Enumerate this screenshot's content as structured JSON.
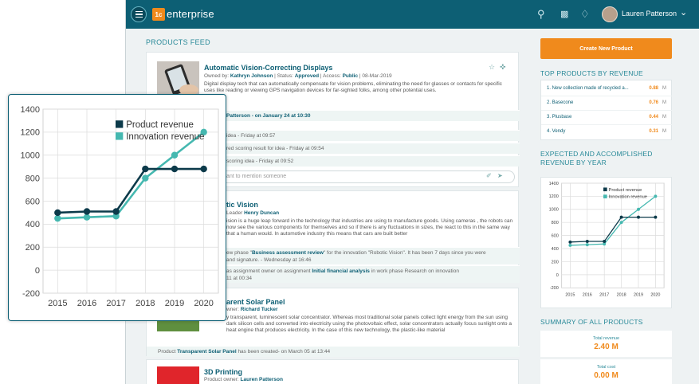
{
  "topbar": {
    "logo_badge": "1c",
    "logo_text": "enterprise",
    "user_name": "Lauren Patterson"
  },
  "feed": {
    "title": "PRODUCTS FEED",
    "card1": {
      "title": "Automatic Vision-Correcting Displays",
      "owned_by_label": "Owned by:",
      "owner": "Kathryn Johnson",
      "status_label": "| Status:",
      "status": "Approved",
      "access_label": "| Access:",
      "access": "Public",
      "date": "| 08-Mar-2019",
      "description": "Digital display tech that can automatically compensate for vision problems, eliminating the need for glasses or contacts for specific uses like reading or viewing GPS navigation devices for far-sighted folks, among other potential uses.",
      "activities": [
        "Patterson - on January 24 at 10:30",
        "idea - Friday at 09:57",
        "red scoring result for idea - Friday at 09:54",
        "scoring idea - Friday at 09:52"
      ],
      "comment_placeholder": "want to mention someone"
    },
    "card2": {
      "title": "tic Vision",
      "leader_label": "Leader",
      "leader": "Henry Duncan",
      "description": "ision is a huge leap forward in the technology that industries are using to manufacture goods. Using cameras , the robots can now see the various components for themselves and so if there is any fluctuations in sizes, the react to this in the same way that a human would. In automotive industry this means that cars are built better",
      "activity1_a": "ew phase \"",
      "activity1_link": "Business assessment review",
      "activity1_b": "\" for the innovation \"Robotic Vision\". It has been 7 days since you were",
      "activity1_c": "and signature. - Wednesday at 16:46",
      "activity2_a": "as assignment owner on assignment ",
      "activity2_link": "Initial financial analysis",
      "activity2_b": " in work phase Research on innovation",
      "activity2_c": "11 at 00:34"
    },
    "card3": {
      "title": "arent Solar Panel",
      "owner_label": "wner:",
      "owner": "Richard Tucker",
      "description": "y transparent, luminescent solar concentrator. Whereas most traditional solar panels collect light energy from the sun using dark silicon cells and converted into electricity using the photovoltaic effect, solar concentrators actually focus sunlight onto a heat engine that produces electricity. In the case of this new technology, the plastic-like material",
      "activity_a": "Product ",
      "activity_link": "Transparent Solar Panel",
      "activity_b": " has been created- on March 05 at 13:44"
    },
    "card4": {
      "title": "3D Printing",
      "owner_label": "Product owner:",
      "owner": "Lauren Patterson"
    }
  },
  "sidebar": {
    "create_button": "Create New Product",
    "top_title": "TOP PRODUCTS BY REVENUE",
    "top_products": [
      {
        "name": "1. New collection made of recycled a...",
        "value": "0.88",
        "unit": "M"
      },
      {
        "name": "2. Basecone",
        "value": "0.76",
        "unit": "M"
      },
      {
        "name": "3. Plusbase",
        "value": "0.44",
        "unit": "M"
      },
      {
        "name": "4. Vendy",
        "value": "0.31",
        "unit": "M"
      }
    ],
    "chart_title": "EXPECTED AND ACCOMPLISHED REVENUE BY YEAR",
    "summary_title": "SUMMARY OF ALL PRODUCTS",
    "summary": [
      {
        "label": "Total revenue",
        "value": "2.40 M"
      },
      {
        "label": "Total cost",
        "value": "0.00 M"
      }
    ]
  },
  "colors": {
    "teal": "#0d5f74",
    "accent": "#f08a1c",
    "series1": "#0c3a4a",
    "series2": "#45b8b0"
  },
  "chart_data": {
    "type": "line",
    "x": [
      "2015",
      "2016",
      "2017",
      "2018",
      "2019",
      "2020"
    ],
    "ylim": [
      -200,
      1400
    ],
    "yticks": [
      -200,
      0,
      200,
      400,
      600,
      800,
      1000,
      1200,
      1400
    ],
    "legend": "top-right",
    "grid": true,
    "series": [
      {
        "name": "Product revenue",
        "values": [
          500,
          510,
          510,
          880,
          880,
          880
        ]
      },
      {
        "name": "Innovation revenue",
        "values": [
          450,
          460,
          470,
          800,
          1000,
          1200
        ]
      }
    ]
  }
}
